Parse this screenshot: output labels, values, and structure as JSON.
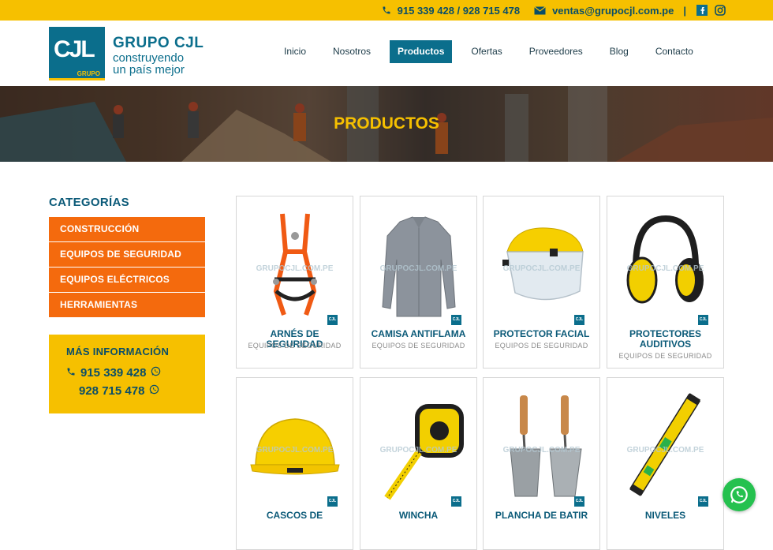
{
  "topbar": {
    "phones": "915 339 428 / 928 715 478",
    "email": "ventas@grupocjl.com.pe",
    "separator": "|"
  },
  "brand": {
    "logo_text": "CJL",
    "logo_sub": "GRUPO",
    "name": "GRUPO CJL",
    "tagline_1": "construyendo",
    "tagline_2": "un país mejor"
  },
  "nav": [
    "Inicio",
    "Nosotros",
    "Productos",
    "Ofertas",
    "Proveedores",
    "Blog",
    "Contacto"
  ],
  "nav_active": "Productos",
  "hero": {
    "title": "PRODUCTOS"
  },
  "sidebar": {
    "title": "CATEGORÍAS",
    "categories": [
      "CONSTRUCCIÓN",
      "EQUIPOS DE SEGURIDAD",
      "EQUIPOS ELÉCTRICOS",
      "HERRAMIENTAS"
    ]
  },
  "info": {
    "title": "MÁS INFORMACIÓN",
    "phone_1": "915 339 428",
    "phone_2": "928 715 478"
  },
  "watermark": "GRUPOCJL.COM.PE",
  "badge": "CJL",
  "products": [
    {
      "name": "ARNÉS DE SEGURIDAD",
      "category": "EQUIPOS DE SEGURIDAD"
    },
    {
      "name": "CAMISA ANTIFLAMA",
      "category": "EQUIPOS DE SEGURIDAD"
    },
    {
      "name": "PROTECTOR FACIAL",
      "category": "EQUIPOS DE SEGURIDAD"
    },
    {
      "name": "PROTECTORES AUDITIVOS",
      "category": "EQUIPOS DE SEGURIDAD"
    },
    {
      "name": "CASCOS DE",
      "category": ""
    },
    {
      "name": "WINCHA",
      "category": ""
    },
    {
      "name": "PLANCHA DE BATIR",
      "category": ""
    },
    {
      "name": "NIVELES",
      "category": ""
    }
  ],
  "colors": {
    "topbar": "#f6c000",
    "brand_blue": "#0b6e8c",
    "category_orange": "#f46a0d",
    "whatsapp_green": "#25c14f"
  }
}
